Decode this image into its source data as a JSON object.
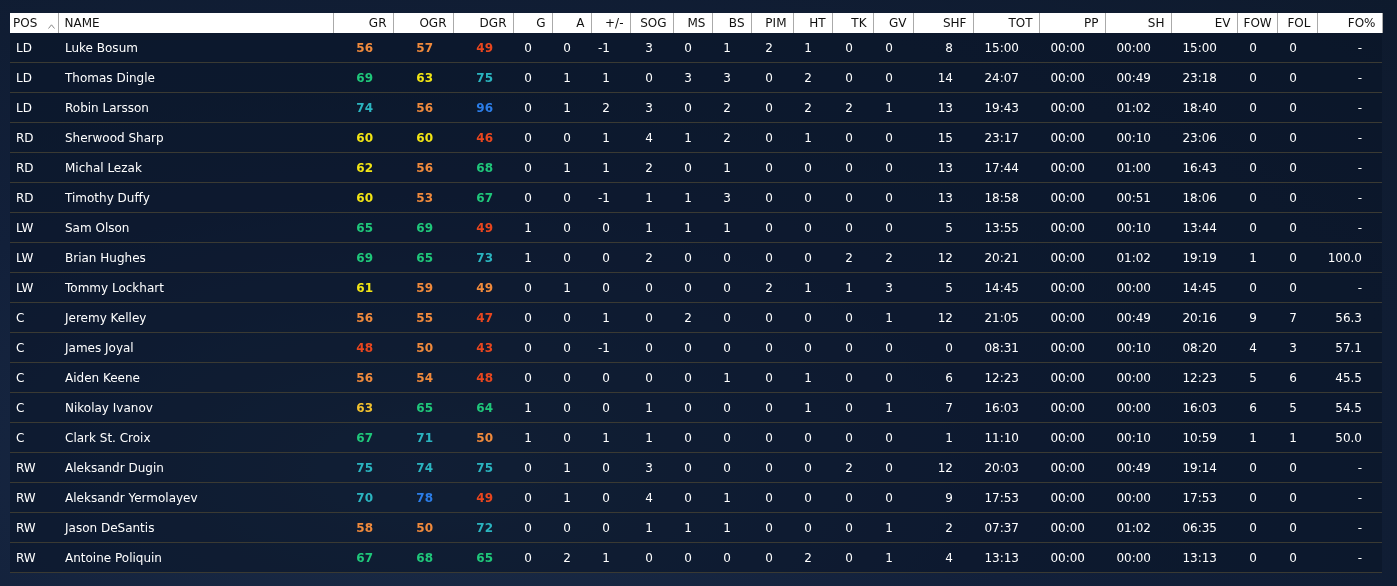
{
  "table": {
    "columns": [
      {
        "label": "POS",
        "sorted": true
      },
      {
        "label": "NAME",
        "sorted": false
      },
      {
        "label": "GR",
        "sorted": false
      },
      {
        "label": "OGR",
        "sorted": false
      },
      {
        "label": "DGR",
        "sorted": false
      },
      {
        "label": "G",
        "sorted": false
      },
      {
        "label": "A",
        "sorted": false
      },
      {
        "label": "+/-",
        "sorted": false
      },
      {
        "label": "SOG",
        "sorted": false
      },
      {
        "label": "MS",
        "sorted": false
      },
      {
        "label": "BS",
        "sorted": false
      },
      {
        "label": "PIM",
        "sorted": false
      },
      {
        "label": "HT",
        "sorted": false
      },
      {
        "label": "TK",
        "sorted": false
      },
      {
        "label": "GV",
        "sorted": false
      },
      {
        "label": "SHF",
        "sorted": false
      },
      {
        "label": "TOT",
        "sorted": false
      },
      {
        "label": "PP",
        "sorted": false
      },
      {
        "label": "SH",
        "sorted": false
      },
      {
        "label": "EV",
        "sorted": false
      },
      {
        "label": "FOW",
        "sorted": false
      },
      {
        "label": "FOL",
        "sorted": false
      },
      {
        "label": "FO%",
        "sorted": false
      }
    ],
    "rows": [
      {
        "pos": "LD",
        "name": "Luke Bosum",
        "ratings": [
          {
            "value": "56",
            "color": "#f08a3c"
          },
          {
            "value": "57",
            "color": "#f08a3c"
          },
          {
            "value": "49",
            "color": "#e8461e"
          }
        ],
        "stats": [
          "0",
          "0",
          "-1",
          "3",
          "0",
          "1",
          "2",
          "1",
          "0",
          "0",
          "8",
          "15:00",
          "00:00",
          "00:00",
          "15:00",
          "0",
          "0",
          "-"
        ]
      },
      {
        "pos": "LD",
        "name": "Thomas Dingle",
        "ratings": [
          {
            "value": "69",
            "color": "#1fc77a"
          },
          {
            "value": "63",
            "color": "#f2e514"
          },
          {
            "value": "75",
            "color": "#2bb5c0"
          }
        ],
        "stats": [
          "0",
          "1",
          "1",
          "0",
          "3",
          "3",
          "0",
          "2",
          "0",
          "0",
          "14",
          "24:07",
          "00:00",
          "00:49",
          "23:18",
          "0",
          "0",
          "-"
        ]
      },
      {
        "pos": "LD",
        "name": "Robin Larsson",
        "ratings": [
          {
            "value": "74",
            "color": "#2bb5c0"
          },
          {
            "value": "56",
            "color": "#f08a3c"
          },
          {
            "value": "96",
            "color": "#2b7de8"
          }
        ],
        "stats": [
          "0",
          "1",
          "2",
          "3",
          "0",
          "2",
          "0",
          "2",
          "2",
          "1",
          "13",
          "19:43",
          "00:00",
          "01:02",
          "18:40",
          "0",
          "0",
          "-"
        ]
      },
      {
        "pos": "RD",
        "name": "Sherwood Sharp",
        "ratings": [
          {
            "value": "60",
            "color": "#f2e514"
          },
          {
            "value": "60",
            "color": "#f2e514"
          },
          {
            "value": "46",
            "color": "#e8461e"
          }
        ],
        "stats": [
          "0",
          "0",
          "1",
          "4",
          "1",
          "2",
          "0",
          "1",
          "0",
          "0",
          "15",
          "23:17",
          "00:00",
          "00:10",
          "23:06",
          "0",
          "0",
          "-"
        ]
      },
      {
        "pos": "RD",
        "name": "Michal Lezak",
        "ratings": [
          {
            "value": "62",
            "color": "#f2e514"
          },
          {
            "value": "56",
            "color": "#f08a3c"
          },
          {
            "value": "68",
            "color": "#1fc77a"
          }
        ],
        "stats": [
          "0",
          "1",
          "1",
          "2",
          "0",
          "1",
          "0",
          "0",
          "0",
          "0",
          "13",
          "17:44",
          "00:00",
          "01:00",
          "16:43",
          "0",
          "0",
          "-"
        ]
      },
      {
        "pos": "RD",
        "name": "Timothy Duffy",
        "ratings": [
          {
            "value": "60",
            "color": "#f2e514"
          },
          {
            "value": "53",
            "color": "#f08a3c"
          },
          {
            "value": "67",
            "color": "#1fc77a"
          }
        ],
        "stats": [
          "0",
          "0",
          "-1",
          "1",
          "1",
          "3",
          "0",
          "0",
          "0",
          "0",
          "13",
          "18:58",
          "00:00",
          "00:51",
          "18:06",
          "0",
          "0",
          "-"
        ]
      },
      {
        "pos": "LW",
        "name": "Sam Olson",
        "ratings": [
          {
            "value": "65",
            "color": "#1fc77a"
          },
          {
            "value": "69",
            "color": "#1fc77a"
          },
          {
            "value": "49",
            "color": "#e8461e"
          }
        ],
        "stats": [
          "1",
          "0",
          "0",
          "1",
          "1",
          "1",
          "0",
          "0",
          "0",
          "0",
          "5",
          "13:55",
          "00:00",
          "00:10",
          "13:44",
          "0",
          "0",
          "-"
        ]
      },
      {
        "pos": "LW",
        "name": "Brian Hughes",
        "ratings": [
          {
            "value": "69",
            "color": "#1fc77a"
          },
          {
            "value": "65",
            "color": "#1fc77a"
          },
          {
            "value": "73",
            "color": "#2bb5c0"
          }
        ],
        "stats": [
          "1",
          "0",
          "0",
          "2",
          "0",
          "0",
          "0",
          "0",
          "2",
          "2",
          "12",
          "20:21",
          "00:00",
          "01:02",
          "19:19",
          "1",
          "0",
          "100.0"
        ]
      },
      {
        "pos": "LW",
        "name": "Tommy Lockhart",
        "ratings": [
          {
            "value": "61",
            "color": "#f2e514"
          },
          {
            "value": "59",
            "color": "#f08a3c"
          },
          {
            "value": "49",
            "color": "#f08a3c"
          }
        ],
        "stats": [
          "0",
          "1",
          "0",
          "0",
          "0",
          "0",
          "2",
          "1",
          "1",
          "3",
          "5",
          "14:45",
          "00:00",
          "00:00",
          "14:45",
          "0",
          "0",
          "-"
        ]
      },
      {
        "pos": "C",
        "name": "Jeremy Kelley",
        "ratings": [
          {
            "value": "56",
            "color": "#f08a3c"
          },
          {
            "value": "55",
            "color": "#f08a3c"
          },
          {
            "value": "47",
            "color": "#e8461e"
          }
        ],
        "stats": [
          "0",
          "0",
          "1",
          "0",
          "2",
          "0",
          "0",
          "0",
          "0",
          "1",
          "12",
          "21:05",
          "00:00",
          "00:49",
          "20:16",
          "9",
          "7",
          "56.3"
        ]
      },
      {
        "pos": "C",
        "name": "James Joyal",
        "ratings": [
          {
            "value": "48",
            "color": "#e8461e"
          },
          {
            "value": "50",
            "color": "#f08a3c"
          },
          {
            "value": "43",
            "color": "#e8461e"
          }
        ],
        "stats": [
          "0",
          "0",
          "-1",
          "0",
          "0",
          "0",
          "0",
          "0",
          "0",
          "0",
          "0",
          "08:31",
          "00:00",
          "00:10",
          "08:20",
          "4",
          "3",
          "57.1"
        ]
      },
      {
        "pos": "C",
        "name": "Aiden Keene",
        "ratings": [
          {
            "value": "56",
            "color": "#f08a3c"
          },
          {
            "value": "54",
            "color": "#f08a3c"
          },
          {
            "value": "48",
            "color": "#e8461e"
          }
        ],
        "stats": [
          "0",
          "0",
          "0",
          "0",
          "0",
          "1",
          "0",
          "1",
          "0",
          "0",
          "6",
          "12:23",
          "00:00",
          "00:00",
          "12:23",
          "5",
          "6",
          "45.5"
        ]
      },
      {
        "pos": "C",
        "name": "Nikolay Ivanov",
        "ratings": [
          {
            "value": "63",
            "color": "#f2c12e"
          },
          {
            "value": "65",
            "color": "#1fc77a"
          },
          {
            "value": "64",
            "color": "#1fc77a"
          }
        ],
        "stats": [
          "1",
          "0",
          "0",
          "1",
          "0",
          "0",
          "0",
          "1",
          "0",
          "1",
          "7",
          "16:03",
          "00:00",
          "00:00",
          "16:03",
          "6",
          "5",
          "54.5"
        ]
      },
      {
        "pos": "C",
        "name": "Clark St. Croix",
        "ratings": [
          {
            "value": "67",
            "color": "#1fc77a"
          },
          {
            "value": "71",
            "color": "#2bb5c0"
          },
          {
            "value": "50",
            "color": "#f08a3c"
          }
        ],
        "stats": [
          "1",
          "0",
          "1",
          "1",
          "0",
          "0",
          "0",
          "0",
          "0",
          "0",
          "1",
          "11:10",
          "00:00",
          "00:10",
          "10:59",
          "1",
          "1",
          "50.0"
        ]
      },
      {
        "pos": "RW",
        "name": "Aleksandr Dugin",
        "ratings": [
          {
            "value": "75",
            "color": "#2bb5c0"
          },
          {
            "value": "74",
            "color": "#2bb5c0"
          },
          {
            "value": "75",
            "color": "#2bb5c0"
          }
        ],
        "stats": [
          "0",
          "1",
          "0",
          "3",
          "0",
          "0",
          "0",
          "0",
          "2",
          "0",
          "12",
          "20:03",
          "00:00",
          "00:49",
          "19:14",
          "0",
          "0",
          "-"
        ]
      },
      {
        "pos": "RW",
        "name": "Aleksandr Yermolayev",
        "ratings": [
          {
            "value": "70",
            "color": "#2bb5c0"
          },
          {
            "value": "78",
            "color": "#2b7de8"
          },
          {
            "value": "49",
            "color": "#e8461e"
          }
        ],
        "stats": [
          "0",
          "1",
          "0",
          "4",
          "0",
          "1",
          "0",
          "0",
          "0",
          "0",
          "9",
          "17:53",
          "00:00",
          "00:00",
          "17:53",
          "0",
          "0",
          "-"
        ]
      },
      {
        "pos": "RW",
        "name": "Jason DeSantis",
        "ratings": [
          {
            "value": "58",
            "color": "#f08a3c"
          },
          {
            "value": "50",
            "color": "#f08a3c"
          },
          {
            "value": "72",
            "color": "#2bb5c0"
          }
        ],
        "stats": [
          "0",
          "0",
          "0",
          "1",
          "1",
          "1",
          "0",
          "0",
          "0",
          "1",
          "2",
          "07:37",
          "00:00",
          "01:02",
          "06:35",
          "0",
          "0",
          "-"
        ]
      },
      {
        "pos": "RW",
        "name": "Antoine Poliquin",
        "ratings": [
          {
            "value": "67",
            "color": "#1fc77a"
          },
          {
            "value": "68",
            "color": "#1fc77a"
          },
          {
            "value": "65",
            "color": "#1fc77a"
          }
        ],
        "stats": [
          "0",
          "2",
          "1",
          "0",
          "0",
          "0",
          "0",
          "2",
          "0",
          "1",
          "4",
          "13:13",
          "00:00",
          "00:00",
          "13:13",
          "0",
          "0",
          "-"
        ]
      }
    ]
  }
}
